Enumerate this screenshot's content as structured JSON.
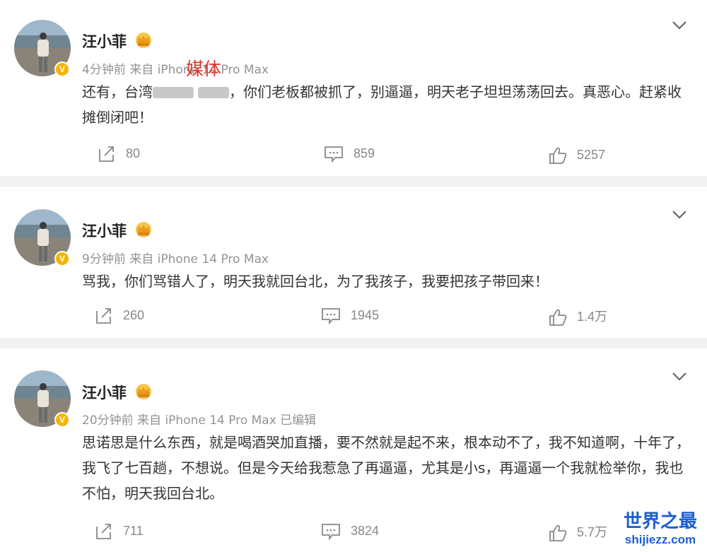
{
  "posts": [
    {
      "author": "汪小菲",
      "verified": "V",
      "meta": "4分钟前  来自 iPhone 14 Pro Max",
      "text_pre": "还有，台湾",
      "text_post": "，你们老板都被抓了，别逼逼，明天老子坦坦荡荡回去。真恶心。赶紧收摊倒闭吧！",
      "repost_count": "80",
      "comment_count": "859",
      "like_count": "5257"
    },
    {
      "author": "汪小菲",
      "verified": "V",
      "meta": "9分钟前  来自 iPhone 14 Pro Max",
      "text": "骂我，你们骂错人了，明天我就回台北，为了我孩子，我要把孩子带回来！",
      "repost_count": "260",
      "comment_count": "1945",
      "like_count": "1.4万"
    },
    {
      "author": "汪小菲",
      "verified": "V",
      "meta": "20分钟前  来自 iPhone 14 Pro Max 已编辑",
      "text": "思诺思是什么东西，就是喝酒哭加直播，要不然就是起不来，根本动不了，我不知道啊，十年了，我飞了七百趟，不想说。但是今天给我惹急了再逼逼，尤其是小s，再逼逼一个我就检举你，我也不怕，明天我回台北。",
      "repost_count": "711",
      "comment_count": "3824",
      "like_count": "5.7万"
    }
  ],
  "overlay_label": "媒体",
  "watermark": {
    "title": "世界之最",
    "url": "shijiezz.com"
  },
  "icons": {
    "repost": "repost-icon",
    "comment": "comment-icon",
    "like": "like-icon",
    "more": "chevron-down-icon",
    "crown": "crown-badge-icon"
  },
  "colors": {
    "background": "#f2f2f2",
    "card": "#ffffff",
    "meta_text": "#939393",
    "verified_badge": "#f5b400",
    "overlay_red": "#e0342a",
    "watermark_blue": "#1d5fd0"
  }
}
